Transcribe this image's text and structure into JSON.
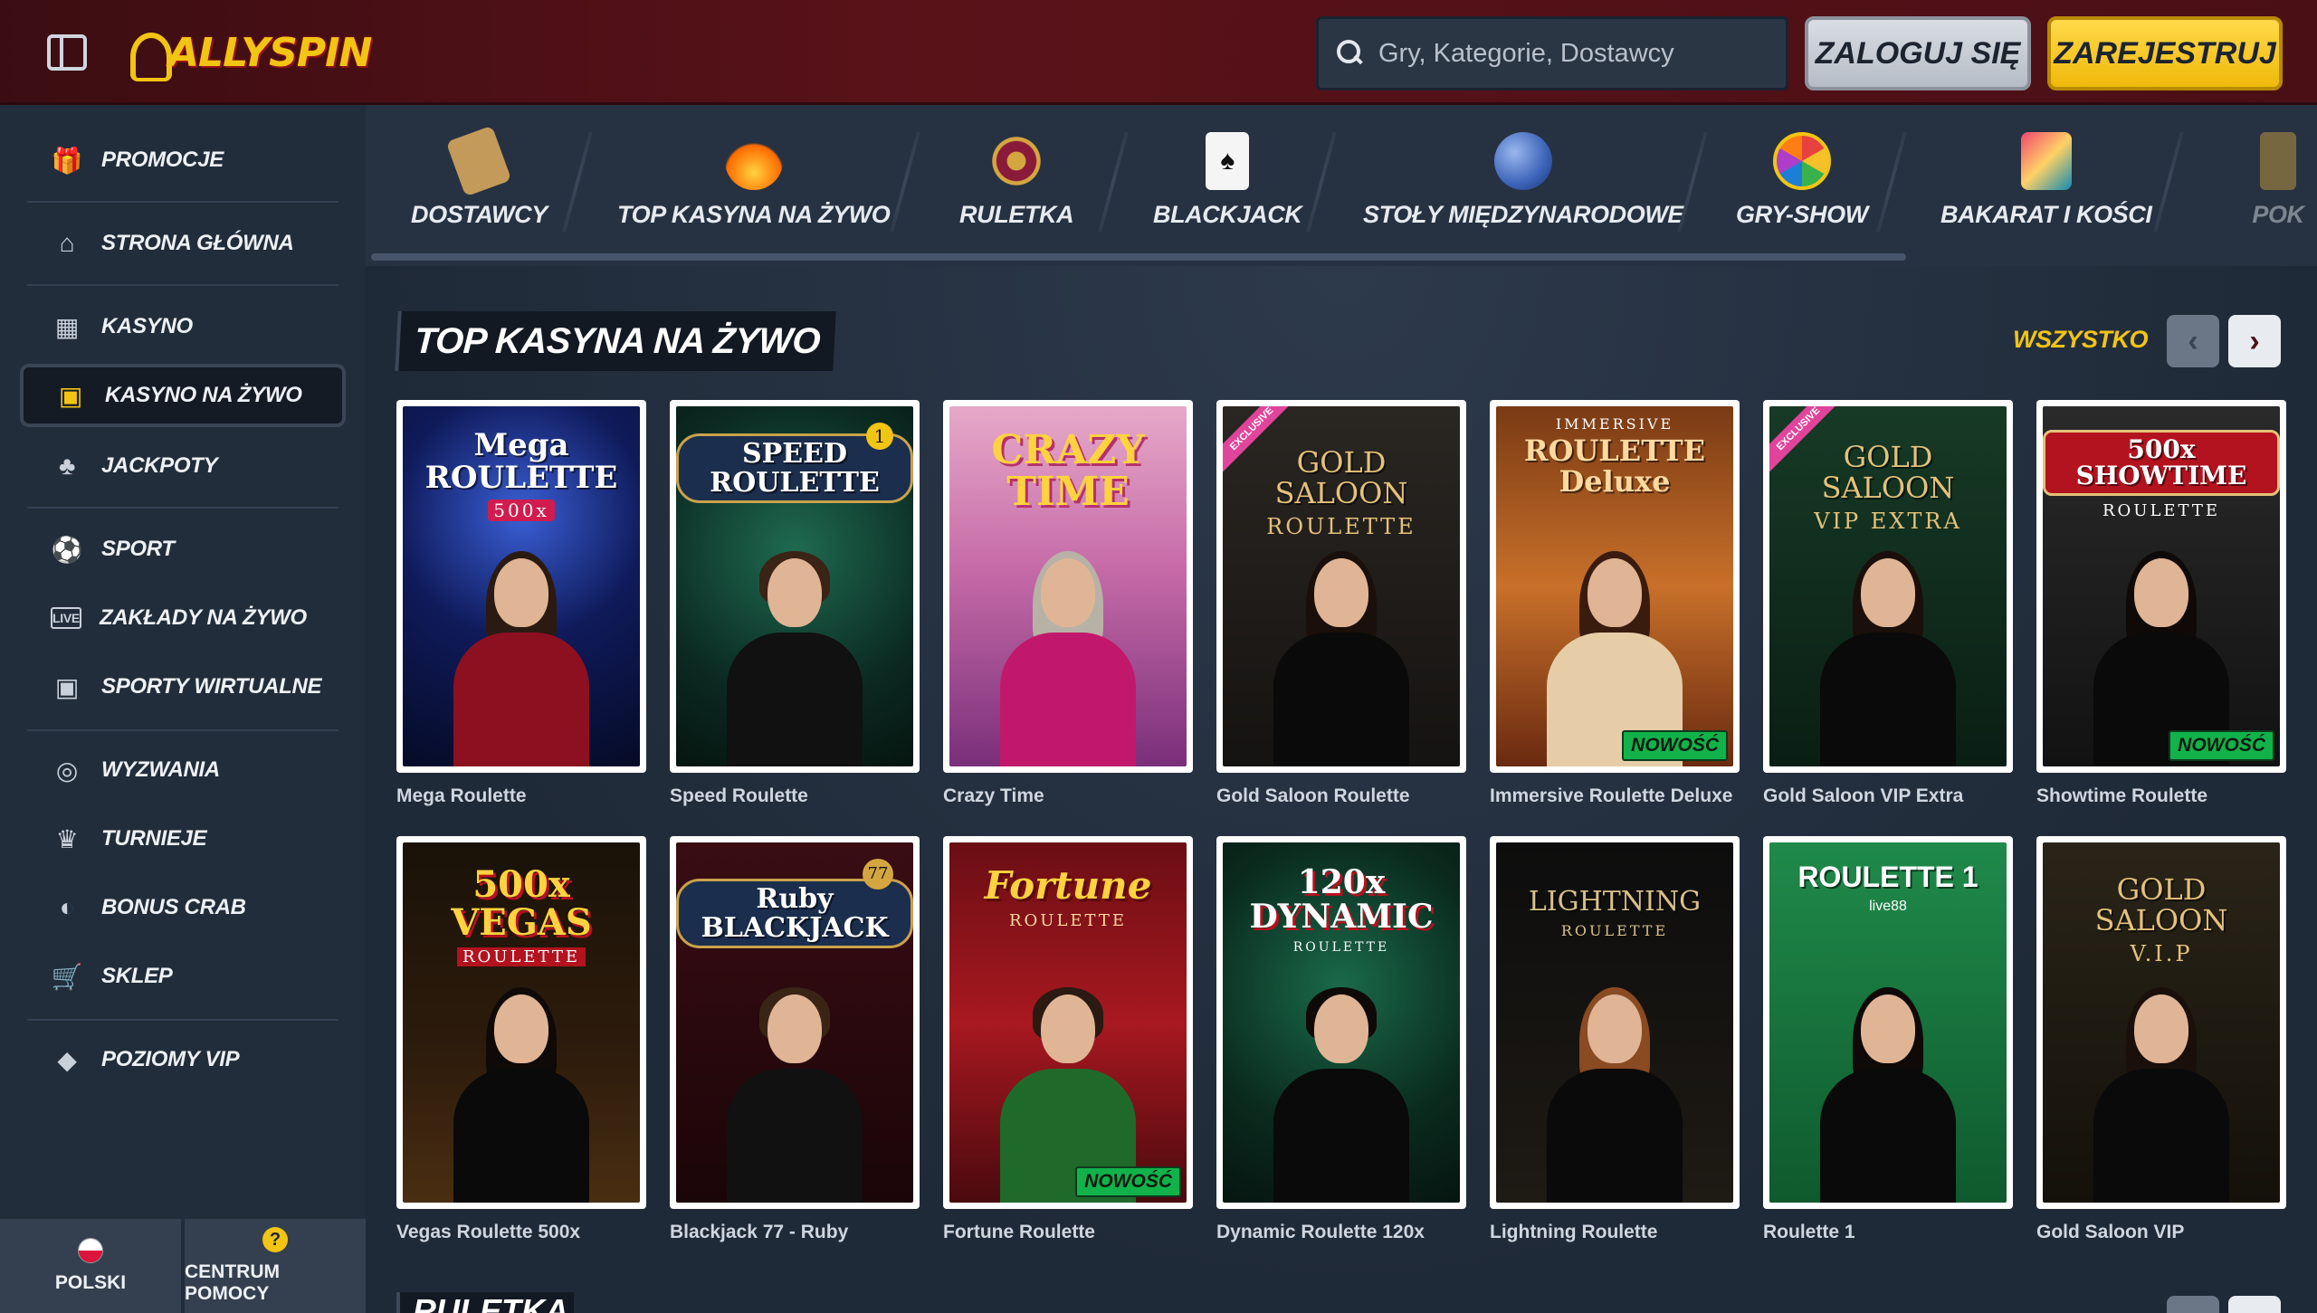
{
  "header": {
    "logo_text": "ALLYSPIN",
    "search_placeholder": "Gry, Kategorie, Dostawcy",
    "login_label": "ZALOGUJ SIĘ",
    "register_label": "ZAREJESTRUJ"
  },
  "sidebar": {
    "items": [
      {
        "label": "PROMOCJE",
        "icon": "gift-icon"
      },
      {
        "label": "STRONA GŁÓWNA",
        "icon": "home-icon"
      },
      {
        "label": "KASYNO",
        "icon": "slot-machine-icon"
      },
      {
        "label": "KASYNO NA ŻYWO",
        "icon": "live-card-icon"
      },
      {
        "label": "JACKPOTY",
        "icon": "clover-icon"
      },
      {
        "label": "SPORT",
        "icon": "football-icon"
      },
      {
        "label": "ZAKŁADY NA ŻYWO",
        "icon": "live-icon"
      },
      {
        "label": "SPORTY WIRTUALNE",
        "icon": "virtual-sports-icon"
      },
      {
        "label": "WYZWANIA",
        "icon": "medal-icon"
      },
      {
        "label": "TURNIEJE",
        "icon": "trophy-icon"
      },
      {
        "label": "BONUS CRAB",
        "icon": "claw-icon"
      },
      {
        "label": "SKLEP",
        "icon": "cart-icon"
      },
      {
        "label": "POZIOMY VIP",
        "icon": "diamond-icon"
      }
    ],
    "active": "KASYNO NA ŻYWO",
    "footer": {
      "language_label": "POLSKI",
      "help_label": "CENTRUM POMOCY",
      "help_glyph": "?"
    }
  },
  "categories": [
    {
      "label": "DOSTAWCY",
      "icon": "scroll-icon"
    },
    {
      "label": "TOP KASYNA NA ŻYWO",
      "icon": "fire-icon"
    },
    {
      "label": "RULETKA",
      "icon": "roulette-icon"
    },
    {
      "label": "BLACKJACK",
      "icon": "cards-icon"
    },
    {
      "label": "STOŁY MIĘDZYNARODOWE",
      "icon": "globe-icon"
    },
    {
      "label": "GRY-SHOW",
      "icon": "wheel-icon"
    },
    {
      "label": "BAKARAT I KOŚCI",
      "icon": "dice-cards-icon"
    },
    {
      "label": "POK",
      "icon": "poker-icon"
    }
  ],
  "section": {
    "title": "TOP KASYNA NA ŻYWO",
    "all_label": "WSZYSTKO",
    "next_title": "RULETKA"
  },
  "games": [
    {
      "name": "Mega Roulette",
      "art_title": "Mega ROULETTE",
      "art_sub": "500x",
      "new": false,
      "exclusive": false
    },
    {
      "name": "Speed Roulette",
      "art_title": "SPEED ROULETTE",
      "art_sub": "1",
      "new": false,
      "exclusive": false
    },
    {
      "name": "Crazy Time",
      "art_title": "CRAZY TIME",
      "art_sub": "",
      "new": false,
      "exclusive": false
    },
    {
      "name": "Gold Saloon Roulette",
      "art_title": "GOLD SALOON",
      "art_sub": "ROULETTE",
      "new": false,
      "exclusive": true
    },
    {
      "name": "Immersive Roulette Deluxe",
      "art_title": "ROULETTE Deluxe",
      "art_sub": "IMMERSIVE",
      "new": true,
      "exclusive": false
    },
    {
      "name": "Gold Saloon VIP Extra",
      "art_title": "GOLD SALOON",
      "art_sub": "VIP EXTRA",
      "new": false,
      "exclusive": true
    },
    {
      "name": "Showtime Roulette",
      "art_title": "500x SHOWTIME",
      "art_sub": "ROULETTE",
      "new": true,
      "exclusive": false
    },
    {
      "name": "Vegas Roulette 500x",
      "art_title": "500x VEGAS",
      "art_sub": "ROULETTE",
      "new": false,
      "exclusive": false
    },
    {
      "name": "Blackjack 77 - Ruby",
      "art_title": "Ruby BLACKJACK",
      "art_sub": "77",
      "new": false,
      "exclusive": false
    },
    {
      "name": "Fortune Roulette",
      "art_title": "Fortune",
      "art_sub": "ROULETTE",
      "new": true,
      "exclusive": false
    },
    {
      "name": "Dynamic Roulette 120x",
      "art_title": "120x DYNAMIC",
      "art_sub": "ROULETTE",
      "new": false,
      "exclusive": false
    },
    {
      "name": "Lightning Roulette",
      "art_title": "LIGHTNING",
      "art_sub": "ROULETTE",
      "new": false,
      "exclusive": false
    },
    {
      "name": "Roulette 1",
      "art_title": "ROULETTE 1",
      "art_sub": "live88",
      "new": false,
      "exclusive": false
    },
    {
      "name": "Gold Saloon VIP",
      "art_title": "GOLD SALOON",
      "art_sub": "V.I.P",
      "new": false,
      "exclusive": false
    }
  ],
  "badges": {
    "new_label": "NOWOŚĆ",
    "exclusive_label": "EXCLUSIVE"
  },
  "colors": {
    "accent": "#f2c413",
    "header_bg": "#4a0f15",
    "sidebar_bg": "#222d3b",
    "new_badge": "#12b24a"
  }
}
